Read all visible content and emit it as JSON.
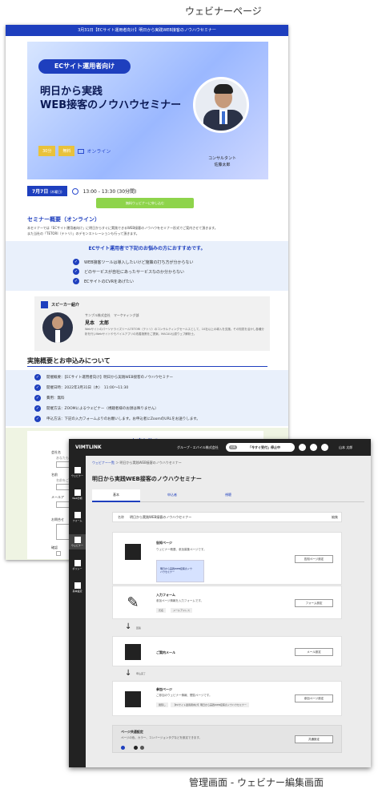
{
  "captions": {
    "top": "ウェビナーページ",
    "bottom": "管理画面 - ウェビナー編集画面"
  },
  "webinar": {
    "banner": "3月31日【ECサイト運用者向け】明日から実践WEB接客のノウハウセミナー",
    "pill": "ECサイト運用者向け",
    "title_line1": "明日から実践",
    "title_line2": "WEB接客のノウハウセミナー",
    "tag_duration": "30分",
    "tag_free": "無料",
    "tag_online": "オンライン",
    "speaker_caption_1": "コンサルタント",
    "speaker_caption_2": "佐藤太郎",
    "date_badge": "7月7日",
    "date_day": "(木曜日)",
    "time": "13:00 - 13:30 (30分間)",
    "apply_button": "無料ウェビナーに申し込む",
    "overview_title": "セミナー概要（オンライン）",
    "overview_body_1": "本セミナーでは「ECサイト運用者向け」に明日からすぐに実践できるWEB接客のノウハウをセミナー形式でご案内させて頂きます。",
    "overview_body_2": "また当社の「TETORI（テトリ）」のデモンストレーションも行って頂きます。",
    "rec_title": "ECサイト運用者で下記のお悩みの方におすすめです。",
    "rec_items": [
      "WEB接客ツールは導入したいけど施策の打ち方が分からない",
      "どのサービスが自社にあったサービスなのか分からない",
      "ECサイトのCVRをあげたい"
    ],
    "speaker_label": "スピーカー紹介",
    "speaker_company": "サンプル株式会社　マーケティング部",
    "speaker_name": "見本　太郎",
    "speaker_bio": "WebサイトのパーソナライズツールTETORI（テトリ）のコンサルティングセールスとして、10社以上の導入を支援。その知見を活かし各種分析を行いWebサイトやモバイルアプリの改善施策をご提案。MACAU公認ウェブ解析士。",
    "overview2_title": "実施概要とお申込みについて",
    "overview2_items": [
      "開催概要：【ECサイト運用者向け】明日から実践WEB接客のノウハウセミナー",
      "開催日時：2022年3月31日（木）　11:00〜11:30",
      "費用：無料",
      "開催方法：ZOOMによるウェビナー（視聴者様のお顔は映りません）",
      "申込方法：下記の入力フォームよりのお願いします。お申込者にZoomのURLをお送りします。"
    ],
    "form_title": "お申し込み",
    "form_label_company": "会社名",
    "form_placeholder_company": "あなたも入力してください",
    "form_label_name": "名前",
    "form_label_name2": "名前をご",
    "form_label_email": "メールア",
    "form_label_inquiry": "お問合せ",
    "form_label_confirm": "確認"
  },
  "admin": {
    "logo": "VIMTLINK",
    "org": "グループ・エバイル株式会社",
    "pill_label": "社長",
    "pill_text": "「今すぐ受付」停止中",
    "user": "山本 太郎",
    "side_items": [
      "ウェビナー",
      "Web分析",
      "フォーム",
      "ウェビナー",
      "ポリシー",
      "基本設定"
    ],
    "crumb_link": "ウェビナー一覧",
    "crumb_rest": "＞ 明日から実践WEB接客のノウハウセミナー",
    "title": "明日から実践WEB接客のノウハウセミナー",
    "tabs": [
      "基本",
      "申込者",
      "視聴"
    ],
    "name_key": "名称",
    "name_value": "明日から実践WEB接客のノウハウセミナー",
    "name_edit": "編集",
    "cards": [
      {
        "title": "告知ページ",
        "desc": "ウェビナー概要、参加募集ページです。",
        "button": "告知ページ設定"
      },
      {
        "title": "入力フォーム",
        "desc": "参加ページ情報を入力フォームです。",
        "button": "フォーム設定",
        "chips": [
          "氏名",
          "メールアドレス"
        ]
      },
      {
        "title": "ご案内メール",
        "desc": "",
        "button": "メール設定"
      },
      {
        "title": "参加ページ",
        "desc": "ご参加のウェビナー情報、閲覧ページです。",
        "button": "参加ページ設定",
        "chips": [
          "閲覧し",
          "【ECサイト運用者向け】明日から実践WEB接客のノウハウセミナー"
        ]
      }
    ],
    "step_labels": [
      "回答",
      "申込完了"
    ],
    "thumb_text": "明日から実践WEB接客のノウハウセミナー",
    "common_title": "ページ共通設定",
    "common_desc": "ページの色、カラー、コンバージョンタグなどを設定できます。",
    "common_button": "共通設定",
    "dot_colors": [
      "#1e3fbe",
      "#e6e6e6",
      "#222222",
      "#555555"
    ]
  }
}
